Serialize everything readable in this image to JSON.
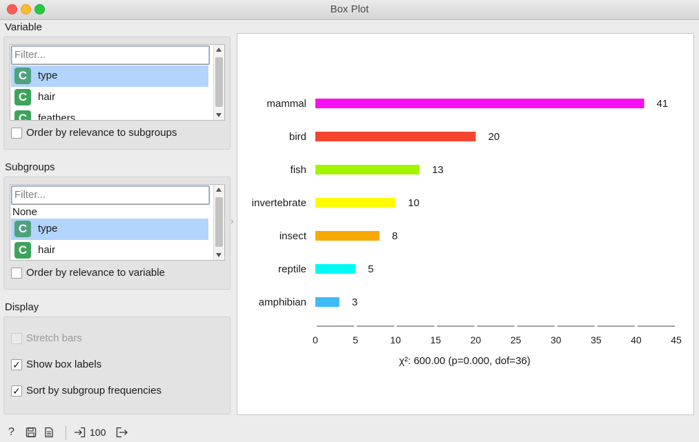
{
  "window": {
    "title": "Box Plot"
  },
  "variable_section": {
    "label": "Variable",
    "filter_placeholder": "Filter...",
    "items": [
      {
        "label": "type",
        "icon": "C",
        "selected": true
      },
      {
        "label": "hair",
        "icon": "C",
        "selected": false
      },
      {
        "label": "feathers",
        "icon": "C",
        "selected": false
      }
    ],
    "order_label": "Order by relevance to subgroups",
    "order_checked": false
  },
  "subgroups_section": {
    "label": "Subgroups",
    "filter_placeholder": "Filter...",
    "none_label": "None",
    "items": [
      {
        "label": "type",
        "icon": "C",
        "selected": true
      },
      {
        "label": "hair",
        "icon": "C",
        "selected": false
      }
    ],
    "order_label": "Order by relevance to variable",
    "order_checked": false
  },
  "display_section": {
    "label": "Display",
    "stretch_label": "Stretch bars",
    "stretch_checked": false,
    "box_labels_label": "Show box labels",
    "box_labels_checked": true,
    "sort_label": "Sort by subgroup frequencies",
    "sort_checked": true
  },
  "chart_data": {
    "type": "bar",
    "orientation": "horizontal",
    "categories": [
      "mammal",
      "bird",
      "fish",
      "invertebrate",
      "insect",
      "reptile",
      "amphibian"
    ],
    "values": [
      41,
      20,
      13,
      10,
      8,
      5,
      3
    ],
    "colors": [
      "#f90ff1",
      "#f4452f",
      "#a3f500",
      "#fffb00",
      "#f9a800",
      "#00faf3",
      "#3fbbf5"
    ],
    "xlim": [
      0,
      45
    ],
    "xticks": [
      0,
      5,
      10,
      15,
      20,
      25,
      30,
      35,
      40,
      45
    ],
    "stat_text": "χ²: 600.00 (p=0.000, dof=36)"
  },
  "statusbar": {
    "count": "100",
    "icons": [
      "help-icon",
      "save-icon",
      "report-icon",
      "input-icon",
      "output-icon"
    ]
  }
}
